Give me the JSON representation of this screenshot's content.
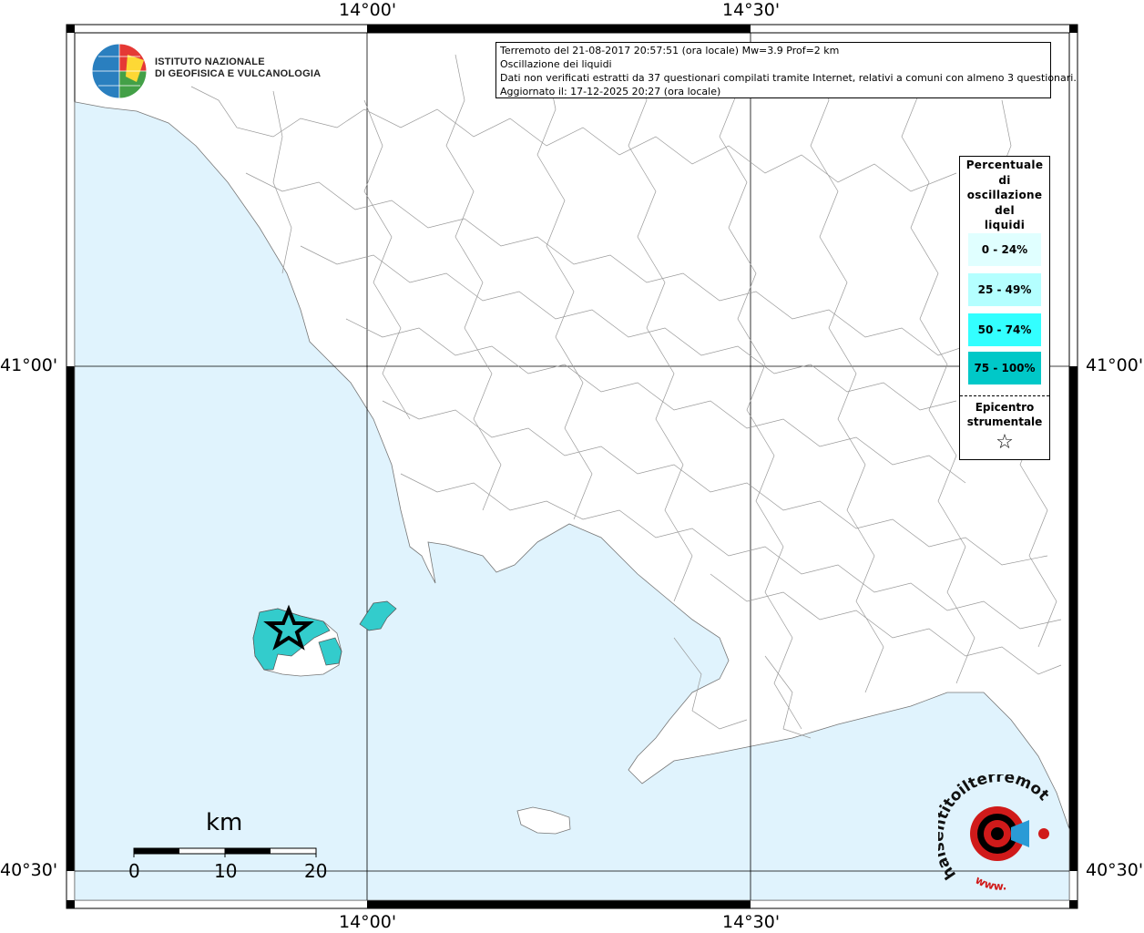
{
  "header": {
    "line1": "Terremoto del 21-08-2017 20:57:51 (ora locale) Mw=3.9 Prof=2 km",
    "line2": "Oscillazione dei liquidi",
    "line3": "Dati non verificati estratti da 37 questionari compilati tramite Internet, relativi a comuni con almeno 3 questionari.",
    "line4": "Aggiornato il: 17-12-2025 20:27 (ora locale)"
  },
  "ingv": {
    "line1": "ISTITUTO NAZIONALE",
    "line2": "DI GEOFISICA E VULCANOLOGIA"
  },
  "axes": {
    "top_left": "14°00'",
    "top_right": "14°30'",
    "bottom_left": "14°00'",
    "bottom_right": "14°30'",
    "left_upper": "41°00'",
    "left_lower": "40°30'",
    "right_upper": "41°00'",
    "right_lower": "40°30'"
  },
  "legend": {
    "title_lines": [
      "Percentuale",
      "di",
      "oscillazione",
      "del",
      "liquidi"
    ],
    "classes": [
      {
        "label": "0 - 24%",
        "color": "#e0ffff"
      },
      {
        "label": "25 - 49%",
        "color": "#b4ffff"
      },
      {
        "label": "50 - 74%",
        "color": "#33ffff"
      },
      {
        "label": "75 - 100%",
        "color": "#00c8c8"
      }
    ],
    "epicenter_line1": "Epicentro",
    "epicenter_line2": "strumentale",
    "epicenter_symbol": "☆"
  },
  "scale": {
    "unit": "km",
    "ticks": [
      "0",
      "10",
      "20"
    ]
  },
  "colors": {
    "sea": "#e0f3fd",
    "land": "#ffffff",
    "epicenter_fill": "#33cccc"
  },
  "watermark": {
    "text": "haisentitoilterremoto.it",
    "www": "www."
  }
}
